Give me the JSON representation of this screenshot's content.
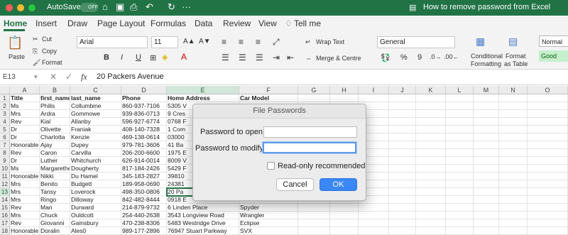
{
  "titlebar": {
    "autosave_label": "AutoSave",
    "autosave_state": "OFF",
    "title": "How to remove password from Excel"
  },
  "ribbon_tabs": [
    "Home",
    "Insert",
    "Draw",
    "Page Layout",
    "Formulas",
    "Data",
    "Review",
    "View",
    "Tell me"
  ],
  "ribbon": {
    "paste": "Paste",
    "cut": "Cut",
    "copy": "Copy",
    "format": "Format",
    "font_name": "Arial",
    "font_size": "11",
    "bold": "B",
    "italic": "I",
    "underline": "U",
    "wrap_text": "Wrap Text",
    "merge_centre": "Merge & Centre",
    "number_format": "General",
    "percent": "%",
    "comma": "9",
    "conditional_formatting_1": "Conditional",
    "conditional_formatting_2": "Formatting",
    "format_as_table_1": "Format",
    "format_as_table_2": "as Table",
    "style_normal": "Normal",
    "style_good": "Good"
  },
  "formula_bar": {
    "name_box": "E13",
    "fx": "fx",
    "value": "20 Packers Avenue"
  },
  "columns": [
    "A",
    "B",
    "C",
    "D",
    "E",
    "F",
    "G",
    "H",
    "I",
    "J",
    "K",
    "L",
    "M",
    "N",
    "O"
  ],
  "rows": [
    [
      "Title",
      "first_name",
      "last_name",
      "Phone",
      "Home Address",
      "Car Model"
    ],
    [
      "Ms",
      "Philis",
      "Collumbine",
      "860-937-7106",
      "5305 V",
      ""
    ],
    [
      "Mrs",
      "Ardra",
      "Gommowe",
      "939-836-0713",
      "9 Cres",
      ""
    ],
    [
      "Rev",
      "Kial",
      "Allanby",
      "596-927-6774",
      "0768 F",
      ""
    ],
    [
      "Dr",
      "Olivette",
      "Franiak",
      "408-140-7328",
      "1 Com",
      ""
    ],
    [
      "Dr",
      "Charlotta",
      "Kenzie",
      "469-138-0614",
      "03000",
      ""
    ],
    [
      "Honorable",
      "Ajay",
      "Dupey",
      "979-781-3606",
      "41 Ba",
      ""
    ],
    [
      "Rev",
      "Caron",
      "Carvilla",
      "206-200-6600",
      "1975 E",
      ""
    ],
    [
      "Dr",
      "Luther",
      "Whitchurch",
      "626-914-0014",
      "8009 V",
      ""
    ],
    [
      "Ms",
      "Margarethe",
      "Dougherty",
      "817-184-2426",
      "5429 F",
      ""
    ],
    [
      "Honorable",
      "Nikki",
      "Du Hamel",
      "345-183-2827",
      "39810",
      ""
    ],
    [
      "Mrs",
      "Benito",
      "Budgett",
      "189-958-0690",
      "24381",
      ""
    ],
    [
      "Mrs",
      "Tansy",
      "Loverock",
      "498-350-0806",
      "20 Pa",
      ""
    ],
    [
      "Mrs",
      "Ringo",
      "Dilloway",
      "842-482-8444",
      "0918 E",
      ""
    ],
    [
      "Rev",
      "Man",
      "Durward",
      "214-879-9732",
      "6 Linden Place",
      "Spyder"
    ],
    [
      "Mrs",
      "Chuck",
      "Ouldcott",
      "254-440-2638",
      "3543 Longview Road",
      "Wrangler"
    ],
    [
      "Rev",
      "Giovanni",
      "Gainsbury",
      "470-238-8306",
      "5483 Westridge Drive",
      "Eclipse"
    ],
    [
      "Honorable",
      "Doralin",
      "Ales0",
      "989-177-2896",
      "76947 Stuart Parkway",
      "SVX"
    ]
  ],
  "dialog": {
    "title": "File Passwords",
    "open_label": "Password to open:",
    "modify_label": "Password to modify:",
    "open_value": "",
    "modify_value": "",
    "readonly_label": "Read-only recommended",
    "cancel": "Cancel",
    "ok": "OK"
  }
}
